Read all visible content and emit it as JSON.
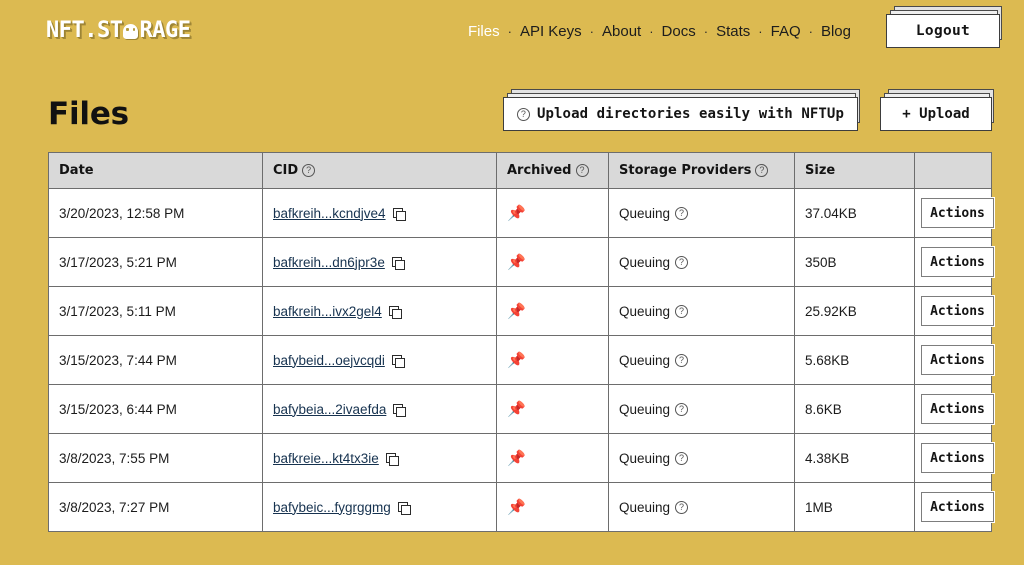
{
  "brand": {
    "prefix": "NFT.ST",
    "suffix": "RAGE",
    "icon": "ghost-logo"
  },
  "nav": {
    "separator": "·",
    "items": [
      {
        "label": "Files",
        "active": true
      },
      {
        "label": "API Keys",
        "active": false
      },
      {
        "label": "About",
        "active": false
      },
      {
        "label": "Docs",
        "active": false
      },
      {
        "label": "Stats",
        "active": false
      },
      {
        "label": "FAQ",
        "active": false
      },
      {
        "label": "Blog",
        "active": false
      }
    ],
    "logout_label": "Logout"
  },
  "page": {
    "title": "Files",
    "nftup_label": "Upload directories easily with NFTUp",
    "upload_label": "+ Upload"
  },
  "table": {
    "headers": {
      "date": "Date",
      "cid": "CID",
      "archived": "Archived",
      "storage_providers": "Storage Providers",
      "size": "Size",
      "actions": ""
    },
    "help_icon": "?",
    "copy_icon": "copy-icon",
    "pin_icon": "📌",
    "actions_label": "Actions",
    "rows": [
      {
        "date": "3/20/2023, 12:58 PM",
        "cid": "bafkreih...kcndjve4",
        "archived": "📌",
        "storage_provider": "Queuing",
        "size": "37.04KB",
        "actions": "Actions"
      },
      {
        "date": "3/17/2023, 5:21 PM",
        "cid": "bafkreih...dn6jpr3e",
        "archived": "📌",
        "storage_provider": "Queuing",
        "size": "350B",
        "actions": "Actions"
      },
      {
        "date": "3/17/2023, 5:11 PM",
        "cid": "bafkreih...ivx2gel4",
        "archived": "📌",
        "storage_provider": "Queuing",
        "size": "25.92KB",
        "actions": "Actions"
      },
      {
        "date": "3/15/2023, 7:44 PM",
        "cid": "bafybeid...oejvcqdi",
        "archived": "📌",
        "storage_provider": "Queuing",
        "size": "5.68KB",
        "actions": "Actions"
      },
      {
        "date": "3/15/2023, 6:44 PM",
        "cid": "bafybeia...2ivaefda",
        "archived": "📌",
        "storage_provider": "Queuing",
        "size": "8.6KB",
        "actions": "Actions"
      },
      {
        "date": "3/8/2023, 7:55 PM",
        "cid": "bafkreie...kt4tx3ie",
        "archived": "📌",
        "storage_provider": "Queuing",
        "size": "4.38KB",
        "actions": "Actions"
      },
      {
        "date": "3/8/2023, 7:27 PM",
        "cid": "bafybeic...fygrggmg",
        "archived": "📌",
        "storage_provider": "Queuing",
        "size": "1MB",
        "actions": "Actions"
      }
    ]
  },
  "colors": {
    "background": "#dcba51",
    "table_header": "#d9d9d9",
    "table_border": "#6d6d6d",
    "link": "#16324f",
    "pin_red": "#d03030",
    "text": "#1a1a1a"
  }
}
